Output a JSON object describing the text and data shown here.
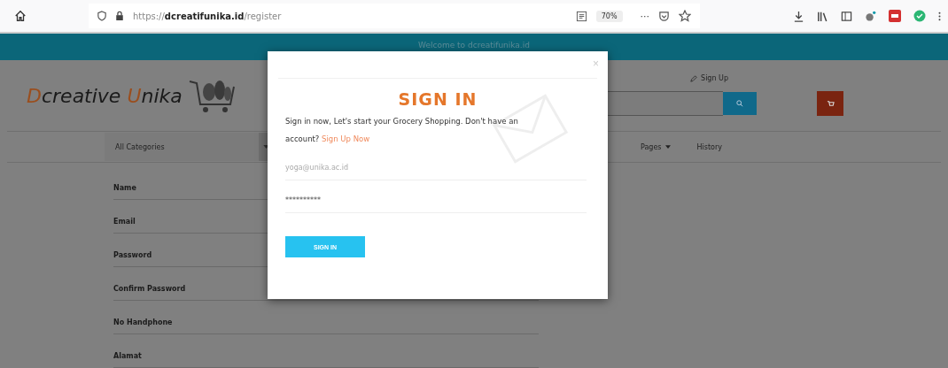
{
  "browser": {
    "url_prefix": "https://",
    "url_domain": "dcreatifunika.id",
    "url_path": "/register",
    "zoom": "70%",
    "more": "···"
  },
  "welcome": "Welcome to dcreatifunika.id",
  "logo": [
    {
      "text": "D",
      "accent": true
    },
    {
      "text": "creative ",
      "accent": false
    },
    {
      "text": "U",
      "accent": true
    },
    {
      "text": "nika",
      "accent": false
    }
  ],
  "sign_up_link": "Sign Up",
  "nav": {
    "category": "All Categories",
    "items": [
      {
        "label": "Pages",
        "dropdown": true
      },
      {
        "label": "History",
        "dropdown": false
      }
    ]
  },
  "form_labels": [
    "Name",
    "Email",
    "Password",
    "Confirm Password",
    "No Handphone",
    "Alamat"
  ],
  "modal": {
    "close": "×",
    "title": "SIGN IN",
    "intro": "Sign in now, Let's start your Grocery Shopping. Don't have an account?",
    "link": "Sign Up Now",
    "email_placeholder": "yoga@unika.ac.id",
    "password_value": "**********",
    "button": "SIGN IN"
  }
}
